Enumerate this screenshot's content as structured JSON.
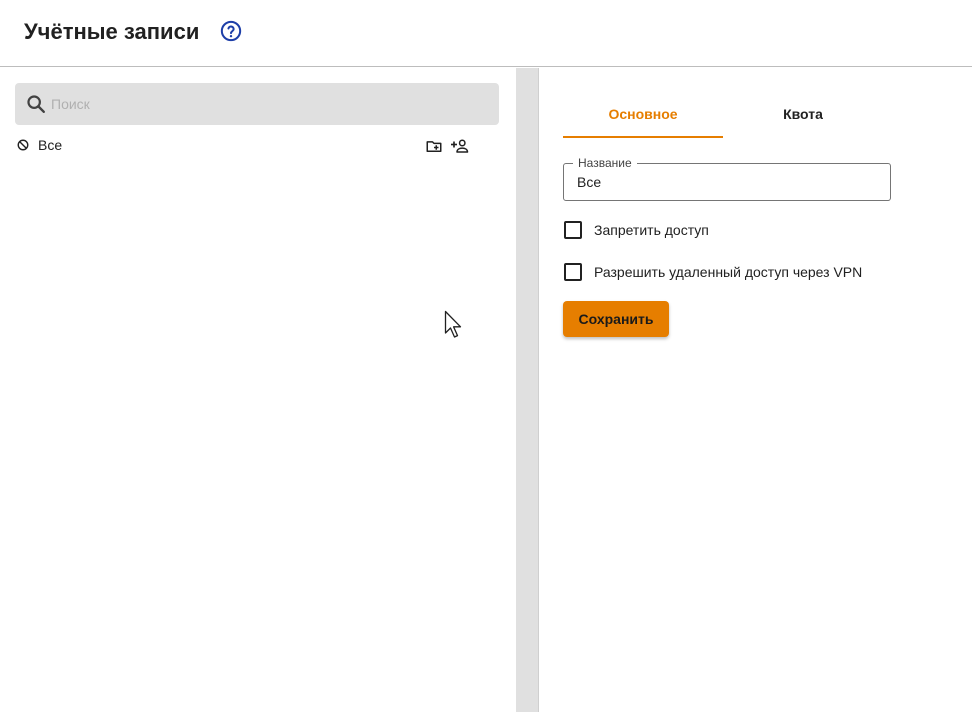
{
  "header": {
    "title": "Учётные записи",
    "help_icon": "help-circle-icon"
  },
  "left_panel": {
    "search": {
      "placeholder": "Поиск",
      "value": "",
      "icon": "search-icon"
    },
    "tree": {
      "root_label": "Все",
      "root_icon": "block-icon",
      "actions": [
        "add-folder-icon",
        "add-user-icon"
      ]
    }
  },
  "right_panel": {
    "tabs": [
      {
        "label": "Основное",
        "active": true
      },
      {
        "label": "Квота",
        "active": false
      }
    ],
    "name_field": {
      "label": "Название",
      "value": "Все"
    },
    "checkboxes": [
      {
        "label": "Запретить доступ",
        "checked": false
      },
      {
        "label": "Разрешить удаленный доступ через VPN",
        "checked": false
      }
    ],
    "save_label": "Сохранить"
  },
  "colors": {
    "accent": "#e67e00",
    "help_icon": "#1e3fa8",
    "search_bg": "#e0e0e0",
    "splitter": "#e0e0e0"
  }
}
